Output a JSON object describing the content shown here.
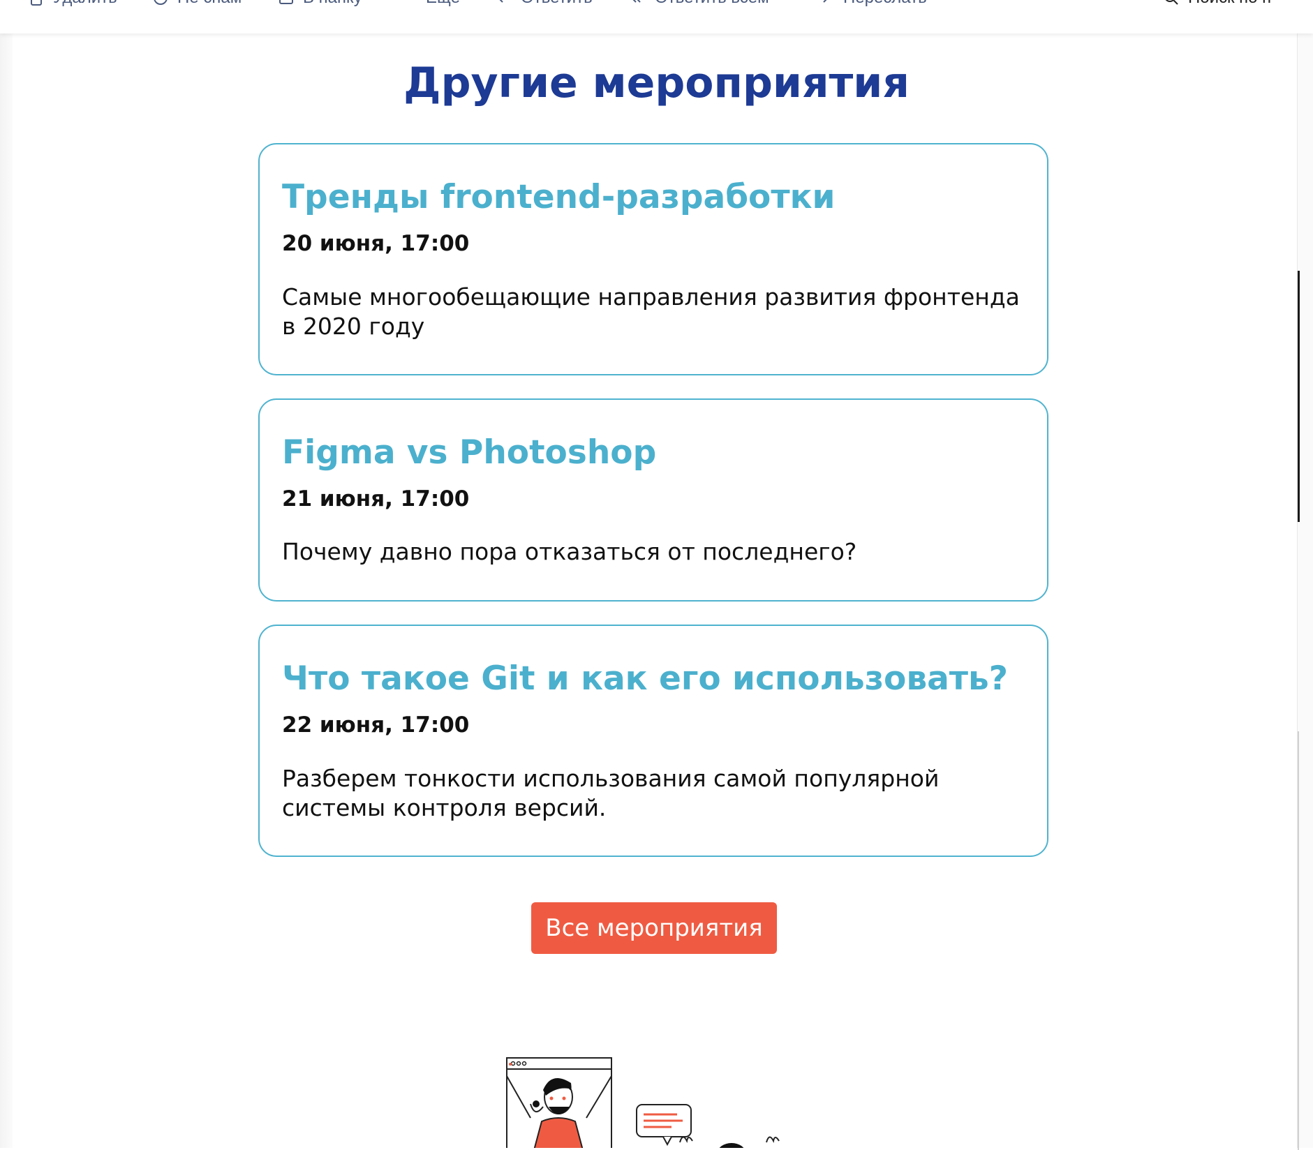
{
  "toolbar": {
    "items": [
      {
        "icon": "trash-icon",
        "label": "Удалить"
      },
      {
        "icon": "spam-icon",
        "label": "Не спам"
      },
      {
        "icon": "folder-icon",
        "label": "В папку"
      },
      {
        "icon": "more-icon",
        "label": "Ещё"
      },
      {
        "icon": "reply-icon",
        "label": "Ответить"
      },
      {
        "icon": "reply-all-icon",
        "label": "Ответить всем"
      },
      {
        "icon": "forward-icon",
        "label": "Переслать"
      },
      {
        "icon": "search-icon",
        "label": "Поиск по п"
      }
    ]
  },
  "section": {
    "title": "Другие мероприятия"
  },
  "events": [
    {
      "title": "Тренды frontend-разработки",
      "date": "20 июня, 17:00",
      "description": "Самые многообещающие направления развития фронтенда в 2020 году"
    },
    {
      "title": "Figma vs Photoshop",
      "date": "21 июня, 17:00",
      "description": "Почему давно пора отказаться от последнего?"
    },
    {
      "title": "Что такое Git и как его использовать?",
      "date": "22 июня, 17:00",
      "description": "Разберем тонкости использования самой популярной системы контроля версий."
    }
  ],
  "cta": {
    "label": "Все мероприятия"
  },
  "colors": {
    "title": "#1d3a94",
    "card_border": "#4fb3cf",
    "card_title": "#4bb0cd",
    "cta_bg": "#ef5b42"
  }
}
